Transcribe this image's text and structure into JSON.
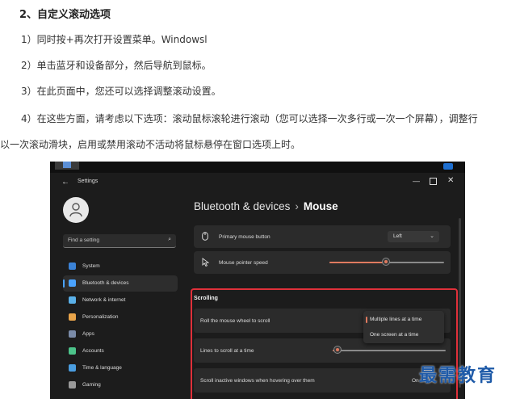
{
  "article": {
    "heading": "2、自定义滚动选项",
    "steps": [
      "1）同时按+再次打开设置菜单。Windowsl",
      "2）单击蓝牙和设备部分，然后导航到鼠标。",
      "3）在此页面中，您还可以选择调整滚动设置。",
      "4）在这些方面，请考虑以下选项：滚动鼠标滚轮进行滚动（您可以选择一次多行或一次一个屏幕），调整行",
      "以一次滚动滑块，启用或禁用滚动不活动将鼠标悬停在窗口选项上时。"
    ]
  },
  "settings": {
    "app_title": "Settings",
    "search_placeholder": "Find a setting",
    "nav": [
      {
        "label": "System",
        "color": "#3b82d6",
        "active": false
      },
      {
        "label": "Bluetooth & devices",
        "color": "#4aa3ff",
        "active": true
      },
      {
        "label": "Network & internet",
        "color": "#5ab0e8",
        "active": false
      },
      {
        "label": "Personalization",
        "color": "#e8a44a",
        "active": false
      },
      {
        "label": "Apps",
        "color": "#7a8ba8",
        "active": false
      },
      {
        "label": "Accounts",
        "color": "#4cc38a",
        "active": false
      },
      {
        "label": "Time & language",
        "color": "#4a9de0",
        "active": false
      },
      {
        "label": "Gaming",
        "color": "#9a9a9a",
        "active": false
      }
    ],
    "breadcrumb": {
      "parent": "Bluetooth & devices",
      "separator": "›",
      "current": "Mouse"
    },
    "primary_button": {
      "label": "Primary mouse button",
      "value": "Left"
    },
    "pointer_speed": {
      "label": "Mouse pointer speed",
      "level": 0.49
    },
    "scrolling": {
      "title": "Scrolling",
      "roll_label": "Roll the mouse wheel to scroll",
      "options": [
        "Multiple lines at a time",
        "One screen at a time"
      ],
      "lines_label": "Lines to scroll at a time",
      "lines_level": 0.04,
      "inactive_label": "Scroll inactive windows when hovering over them",
      "inactive_value": "On"
    }
  },
  "watermark": "最需教育"
}
